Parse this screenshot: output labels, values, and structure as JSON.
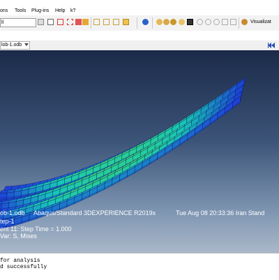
{
  "menubar": {
    "items": [
      "ons",
      "Tools",
      "Plug-ins",
      "Help",
      "k?"
    ]
  },
  "toolbar": {
    "module_combo": "ll",
    "visualization_label": "Visualizat"
  },
  "viewport_header": {
    "odb_select": "lob-1.odb"
  },
  "viewport": {
    "info_line1_file": "ob-1.odb",
    "info_line1_solver": "Abaqus/Standard 3DEXPERIENCE R2019x",
    "info_line1_date": "Tue Aug 08 20:33:36 Iran Stand",
    "info_line2": "tep-1",
    "info_line3": "ent    11: Step Time =    1.000",
    "info_line4": "Var: S, Mises"
  },
  "messages": {
    "line1": " for analysis",
    "line2": "d successfully"
  },
  "colors": {
    "background_top": "#1b2a49",
    "background_bottom": "#aab8c9",
    "mesh_low": "#1f3fd8",
    "mesh_mid": "#17c6b8",
    "mesh_high": "#3fd96a"
  }
}
